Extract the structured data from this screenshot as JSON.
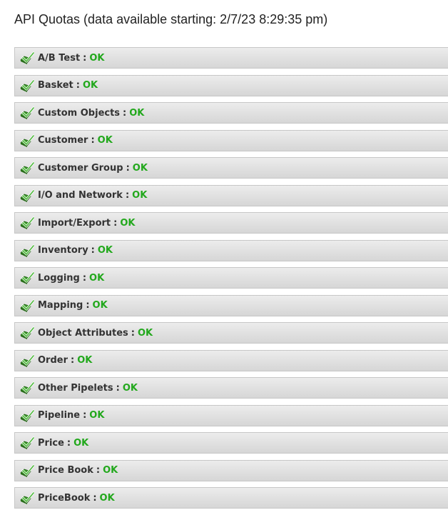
{
  "page": {
    "title": "API Quotas (data available starting: 2/7/23 8:29:35 pm)"
  },
  "colors": {
    "status_ok": "#22a81c",
    "row_background": "#e0e0e0",
    "icon_green": "#3d9a2a"
  },
  "quotas": [
    {
      "name": "A/B Test",
      "separator": ":",
      "status": "OK",
      "icon": "check-folder-icon"
    },
    {
      "name": "Basket",
      "separator": ":",
      "status": "OK",
      "icon": "check-folder-icon"
    },
    {
      "name": "Custom Objects",
      "separator": ":",
      "status": "OK",
      "icon": "check-folder-icon"
    },
    {
      "name": "Customer",
      "separator": ":",
      "status": "OK",
      "icon": "check-folder-icon"
    },
    {
      "name": "Customer Group",
      "separator": ":",
      "status": "OK",
      "icon": "check-folder-icon"
    },
    {
      "name": "I/O and Network",
      "separator": ":",
      "status": "OK",
      "icon": "check-folder-icon"
    },
    {
      "name": "Import/Export",
      "separator": ":",
      "status": "OK",
      "icon": "check-folder-icon"
    },
    {
      "name": "Inventory",
      "separator": ":",
      "status": "OK",
      "icon": "check-folder-icon"
    },
    {
      "name": "Logging",
      "separator": ":",
      "status": "OK",
      "icon": "check-folder-icon"
    },
    {
      "name": "Mapping",
      "separator": ":",
      "status": "OK",
      "icon": "check-folder-icon"
    },
    {
      "name": "Object Attributes",
      "separator": ":",
      "status": "OK",
      "icon": "check-folder-icon"
    },
    {
      "name": "Order",
      "separator": ":",
      "status": "OK",
      "icon": "check-folder-icon"
    },
    {
      "name": "Other Pipelets",
      "separator": ":",
      "status": "OK",
      "icon": "check-folder-icon"
    },
    {
      "name": "Pipeline",
      "separator": ":",
      "status": "OK",
      "icon": "check-folder-icon"
    },
    {
      "name": "Price",
      "separator": ":",
      "status": "OK",
      "icon": "check-folder-icon"
    },
    {
      "name": "Price Book",
      "separator": ":",
      "status": "OK",
      "icon": "check-folder-icon"
    },
    {
      "name": "PriceBook",
      "separator": ":",
      "status": "OK",
      "icon": "check-folder-icon"
    }
  ]
}
